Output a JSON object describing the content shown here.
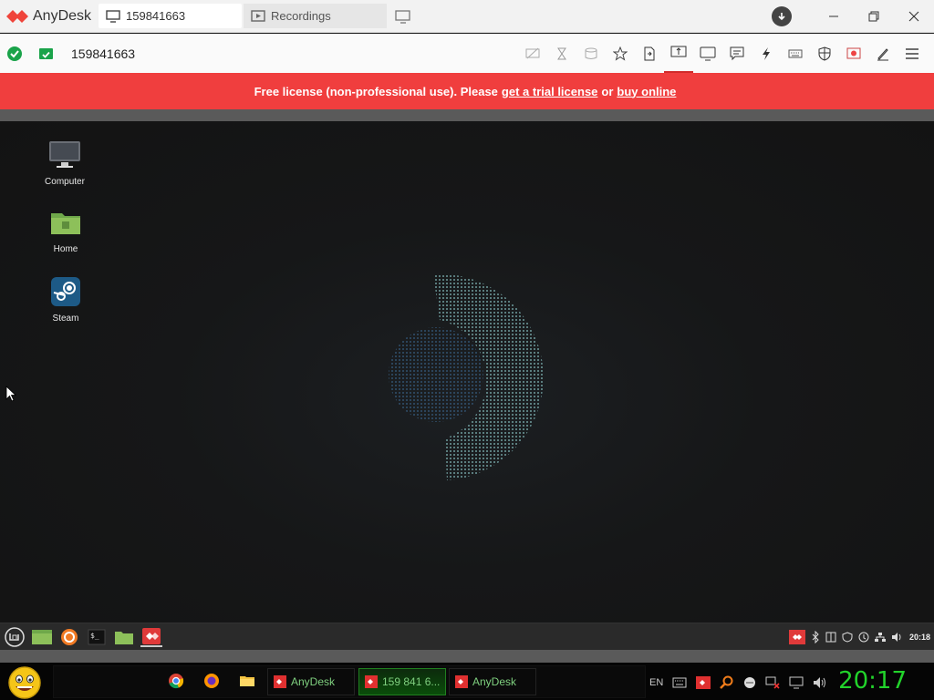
{
  "app": {
    "name": "AnyDesk"
  },
  "tabs": [
    {
      "label": "159841663",
      "active": true,
      "icon": "monitor-icon"
    },
    {
      "label": "Recordings",
      "active": false,
      "icon": "recording-icon"
    }
  ],
  "toolbar": {
    "address": "159841663",
    "icons": [
      "privacy-icon",
      "hourglass-icon",
      "database-icon",
      "favorite-icon",
      "file-transfer-icon",
      "switch-sides-icon",
      "display-icon",
      "chat-icon",
      "actions-icon",
      "keyboard-icon",
      "permissions-icon",
      "record-icon",
      "draw-icon",
      "menu-icon"
    ]
  },
  "banner": {
    "text": "Free license (non-professional use). Please",
    "link1": "get a trial license",
    "mid": "or",
    "link2": "buy online"
  },
  "desktop": {
    "icons": [
      {
        "label": "Computer",
        "icon": "computer-icon"
      },
      {
        "label": "Home",
        "icon": "folder-icon"
      },
      {
        "label": "Steam",
        "icon": "steam-icon"
      }
    ]
  },
  "remote_panel": {
    "clock": "20:18"
  },
  "taskbar": {
    "items": [
      {
        "label": "AnyDesk",
        "active": false
      },
      {
        "label": "159 841 6...",
        "active": true
      },
      {
        "label": "AnyDesk",
        "active": false
      }
    ],
    "lang": "EN",
    "clock": "20:17"
  },
  "colors": {
    "accent": "#f03e3e",
    "clock": "#22d32b",
    "ok": "#1aa34a"
  }
}
